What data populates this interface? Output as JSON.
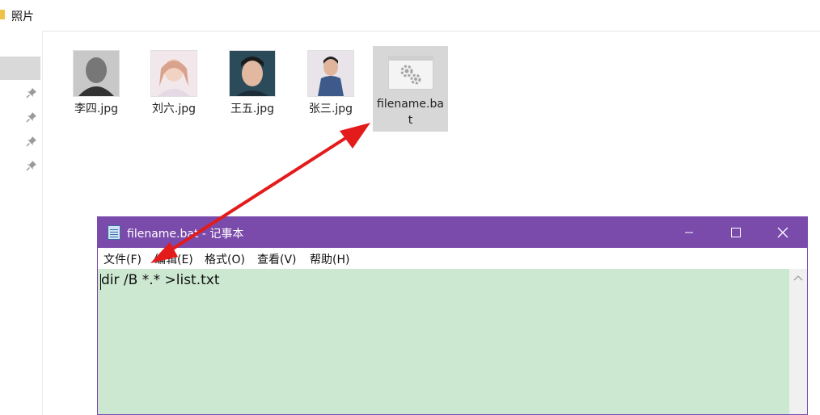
{
  "explorer": {
    "title": "照片",
    "files": [
      {
        "name": "李四.jpg"
      },
      {
        "name": "刘六.jpg"
      },
      {
        "name": "王五.jpg"
      },
      {
        "name": "张三.jpg"
      }
    ],
    "bat_file": {
      "name": "filename.bat"
    }
  },
  "notepad": {
    "title": "filename.bat - 记事本",
    "menu": [
      "文件(F)",
      "编辑(E)",
      "格式(O)",
      "查看(V)",
      "帮助(H)"
    ],
    "content": "dir /B *.* >list.txt"
  },
  "colors": {
    "notepad_title_bg": "#7a4bab",
    "text_area_bg": "#cce8d0",
    "arrow": "#e31b1b"
  }
}
